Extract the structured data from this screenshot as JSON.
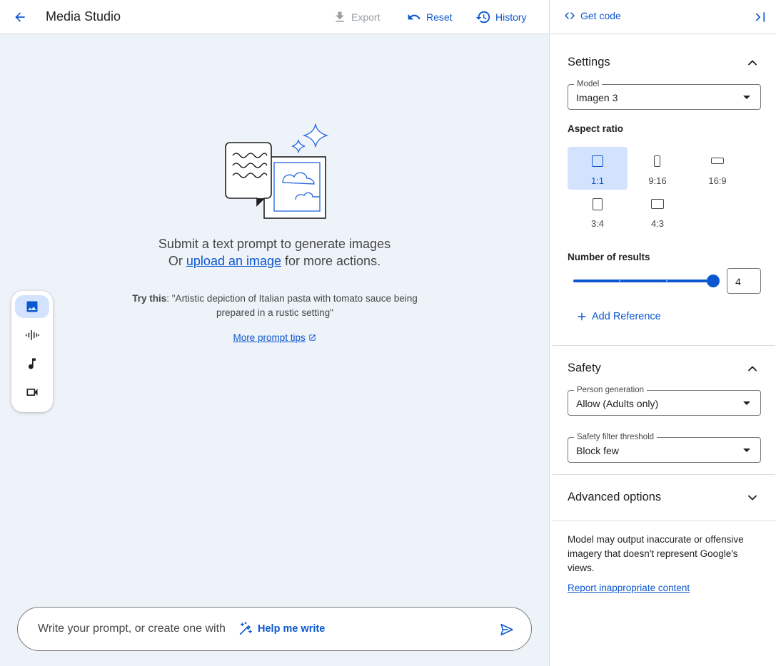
{
  "header": {
    "title": "Media Studio",
    "export_label": "Export",
    "reset_label": "Reset",
    "history_label": "History"
  },
  "empty_state": {
    "line1": "Submit a text prompt to generate images",
    "line2_prefix": "Or ",
    "line2_link": "upload an image",
    "line2_suffix": " for more actions.",
    "try_label": "Try this",
    "try_text": ": \"Artistic depiction of Italian pasta with tomato sauce being prepared in a rustic setting\"",
    "tips_label": "More prompt tips"
  },
  "modes": [
    {
      "name": "image",
      "icon": "image-icon",
      "active": true
    },
    {
      "name": "speech",
      "icon": "waveform-icon",
      "active": false
    },
    {
      "name": "music",
      "icon": "music-note-icon",
      "active": false
    },
    {
      "name": "video",
      "icon": "videocam-icon",
      "active": false
    }
  ],
  "prompt": {
    "placeholder": "Write your prompt, or create one with",
    "help_label": "Help me write"
  },
  "panel": {
    "get_code_label": "Get code",
    "settings": {
      "title": "Settings",
      "model_label": "Model",
      "model_value": "Imagen 3",
      "aspect_ratio_label": "Aspect ratio",
      "aspect_ratios": [
        "1:1",
        "9:16",
        "16:9",
        "3:4",
        "4:3"
      ],
      "aspect_ratio_selected": "1:1",
      "results_label": "Number of results",
      "results_value": "4",
      "results_min": 1,
      "results_max": 4,
      "add_reference_label": "Add Reference"
    },
    "safety": {
      "title": "Safety",
      "person_label": "Person generation",
      "person_value": "Allow (Adults only)",
      "filter_label": "Safety filter threshold",
      "filter_value": "Block few"
    },
    "advanced": {
      "title": "Advanced options"
    },
    "disclaimer": "Model may output inaccurate or offensive imagery that doesn't represent Google's views.",
    "report_label": "Report inappropriate content"
  },
  "colors": {
    "accent": "#0b57d0",
    "accent_container": "#d3e3fd",
    "canvas_bg": "#eef2f9",
    "text": "#1f1f1f",
    "muted": "#444746",
    "disabled": "#9aa0a6"
  }
}
